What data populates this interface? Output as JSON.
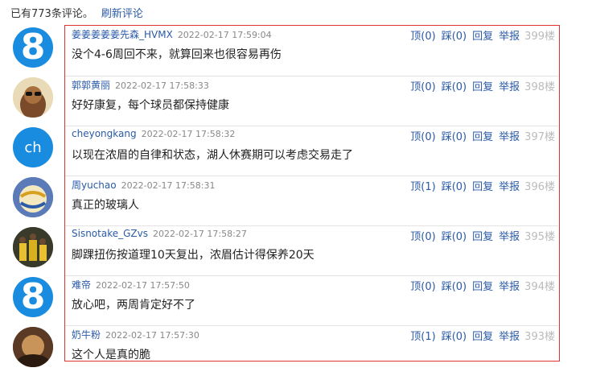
{
  "header": {
    "count_text": "已有773条评论。",
    "refresh_label": "刷新评论"
  },
  "comments": [
    {
      "avatar": "eight",
      "avatar_text": "8",
      "user": "姜姜姜姜姜先森_HVMX",
      "time": "2022-02-17 17:59:04",
      "text": "没个4-6周回不来，就算回来也很容易再伤",
      "up": "顶(0)",
      "down": "踩(0)",
      "reply": "回复",
      "report": "举报",
      "floor": "399楼"
    },
    {
      "avatar": "cartoon",
      "user": "郭郭黄丽",
      "time": "2022-02-17 17:58:33",
      "text": "好好康复，每个球员都保持健康",
      "up": "顶(0)",
      "down": "踩(0)",
      "reply": "回复",
      "report": "举报",
      "floor": "398楼"
    },
    {
      "avatar": "ch",
      "avatar_text": "ch",
      "user": "cheyongkang",
      "time": "2022-02-17 17:58:32",
      "text": "以现在浓眉的自律和状态，湖人休赛期可以考虑交易走了",
      "up": "顶(0)",
      "down": "踩(0)",
      "reply": "回复",
      "report": "举报",
      "floor": "397楼"
    },
    {
      "avatar": "ball",
      "user": "周yuchao",
      "time": "2022-02-17 17:58:31",
      "text": "真正的玻璃人",
      "up": "顶(1)",
      "down": "踩(0)",
      "reply": "回复",
      "report": "举报",
      "floor": "396楼"
    },
    {
      "avatar": "team",
      "user": "Sisnotake_GZvs",
      "time": "2022-02-17 17:58:27",
      "text": "脚踝扭伤按道理10天复出，浓眉估计得保养20天",
      "up": "顶(0)",
      "down": "踩(0)",
      "reply": "回复",
      "report": "举报",
      "floor": "395楼"
    },
    {
      "avatar": "eight",
      "avatar_text": "8",
      "user": "难帝",
      "time": "2022-02-17 17:57:50",
      "text": "放心吧，两周肯定好不了",
      "up": "顶(0)",
      "down": "踩(0)",
      "reply": "回复",
      "report": "举报",
      "floor": "394楼"
    },
    {
      "avatar": "dark",
      "user": "奶牛粉",
      "time": "2022-02-17 17:57:30",
      "text": "这个人是真的脆",
      "up": "顶(1)",
      "down": "踩(0)",
      "reply": "回复",
      "report": "举报",
      "floor": "393楼"
    }
  ]
}
